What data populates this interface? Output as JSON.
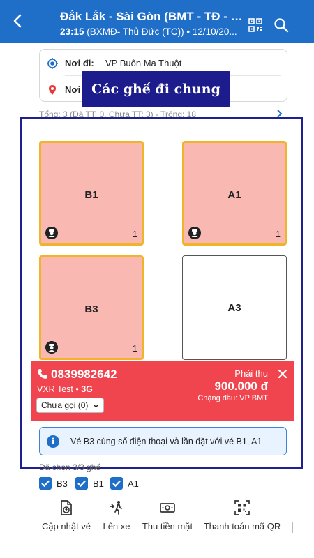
{
  "header": {
    "title": "Đắk Lắk - Sài Gòn (BMT - TĐ - B...",
    "time": "23:15",
    "subtitle_rest": "(BXMĐ- Thủ Đức (TC)) • 12/10/20..."
  },
  "route": {
    "from_label": "Nơi đi:",
    "from_value": "VP Buôn Ma Thuột",
    "to_label": "Nơi"
  },
  "overlay_label": "Các ghế đi chung",
  "summary": "Tổng: 3 (Đã TT: 0, Chưa TT: 3) - Trống: 18",
  "seats": [
    {
      "code": "B1",
      "count": "1",
      "status": "taken"
    },
    {
      "code": "A1",
      "count": "1",
      "status": "taken"
    },
    {
      "code": "B3",
      "count": "1",
      "status": "taken"
    },
    {
      "code": "A3",
      "count": "",
      "status": "empty"
    }
  ],
  "passenger": {
    "phone": "0839982642",
    "name": "VXR Test",
    "network": "3G",
    "call_status": "Chưa gọi (0)",
    "pay_label": "Phải thu",
    "pay_amount": "900.000 đ",
    "pay_note": "Chặng đầu: VP BMT"
  },
  "info_message": "Vé B3 cùng số điện thoại và lần đặt với vé B1, A1",
  "chosen_label": "Đã chọn 3/3 ghế",
  "checked_seats": [
    "B3",
    "B1",
    "A1"
  ],
  "toolbar": [
    {
      "label": "Cập nhật vé",
      "icon": "update-ticket-icon"
    },
    {
      "label": "Lên xe",
      "icon": "board-bus-icon"
    },
    {
      "label": "Thu tiền mặt",
      "icon": "cash-icon"
    },
    {
      "label": "Thanh toán mã QR",
      "icon": "qr-pay-icon"
    }
  ],
  "colors": {
    "header": "#1f6fc9",
    "seat_taken": "#fab8b2",
    "seat_border": "#f0b429",
    "passenger_card": "#f0454f",
    "overlay": "#1c1c8c"
  }
}
